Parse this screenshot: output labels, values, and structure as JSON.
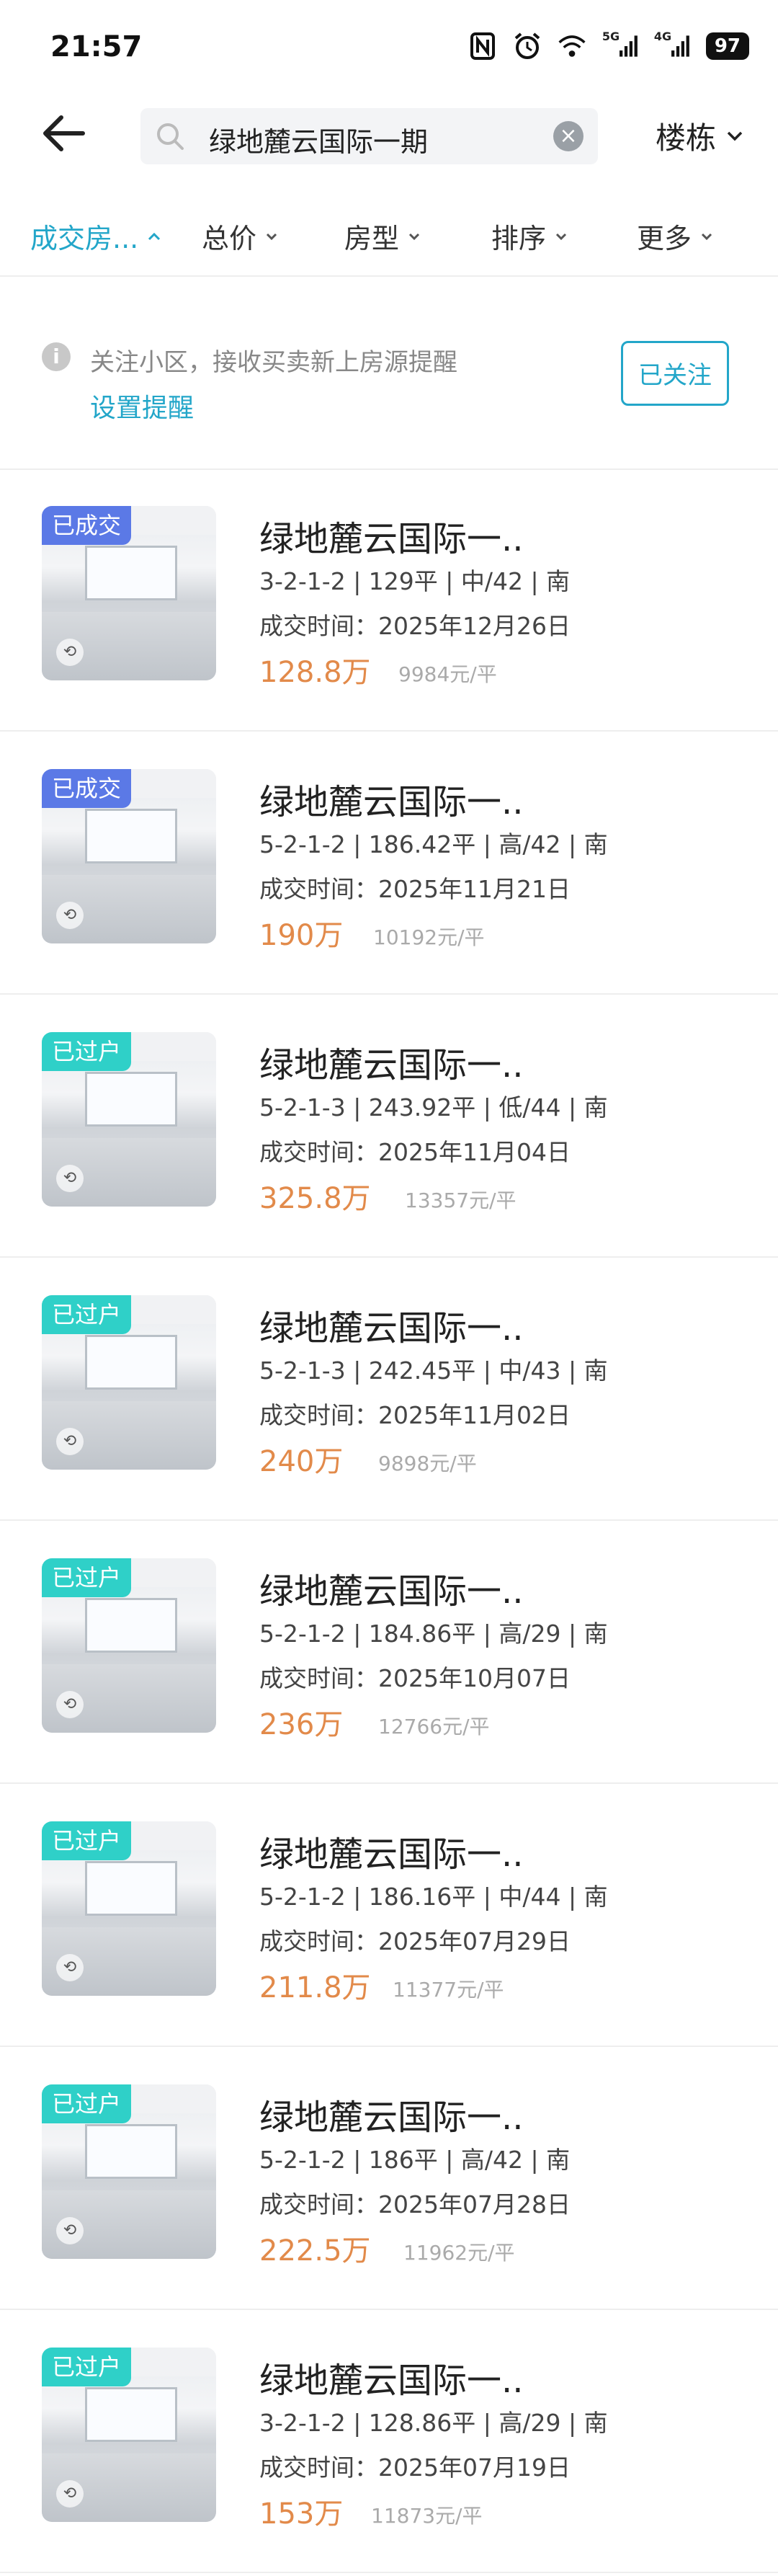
{
  "status_bar": {
    "time": "21:57",
    "battery": "97",
    "network_1": "5G",
    "network_2": "4G"
  },
  "search": {
    "value": "绿地麓云国际一期",
    "clear_icon": "clear-icon"
  },
  "building_filter": {
    "label": "楼栋"
  },
  "filters": [
    {
      "label": "成交房...",
      "active": true
    },
    {
      "label": "总价",
      "active": false
    },
    {
      "label": "房型",
      "active": false
    },
    {
      "label": "排序",
      "active": false
    },
    {
      "label": "更多",
      "active": false
    }
  ],
  "follow": {
    "message": "关注小区，接收买卖新上房源提醒",
    "link": "设置提醒",
    "button": "已关注"
  },
  "colors": {
    "accent": "#23a6c9",
    "price": "#e28a4a",
    "badge_sold": "#5b79e6",
    "badge_transferred": "#2fd0c8"
  },
  "listings": [
    {
      "badge": "已成交",
      "title": "绿地麓云国际一..",
      "specs": "3-2-1-2 | 129平 | 中/42 | 南",
      "date": "成交时间：2025年12月26日",
      "price": "128.8万",
      "unit_price": "9984元/平"
    },
    {
      "badge": "已成交",
      "title": "绿地麓云国际一..",
      "specs": "5-2-1-2 | 186.42平 | 高/42 | 南",
      "date": "成交时间：2025年11月21日",
      "price": "190万",
      "unit_price": "10192元/平"
    },
    {
      "badge": "已过户",
      "title": "绿地麓云国际一..",
      "specs": "5-2-1-3 | 243.92平 | 低/44 | 南",
      "date": "成交时间：2025年11月04日",
      "price": "325.8万",
      "unit_price": "13357元/平"
    },
    {
      "badge": "已过户",
      "title": "绿地麓云国际一..",
      "specs": "5-2-1-3 | 242.45平 | 中/43 | 南",
      "date": "成交时间：2025年11月02日",
      "price": "240万",
      "unit_price": "9898元/平"
    },
    {
      "badge": "已过户",
      "title": "绿地麓云国际一..",
      "specs": "5-2-1-2 | 184.86平 | 高/29 | 南",
      "date": "成交时间：2025年10月07日",
      "price": "236万",
      "unit_price": "12766元/平"
    },
    {
      "badge": "已过户",
      "title": "绿地麓云国际一..",
      "specs": "5-2-1-2 | 186.16平 | 中/44 | 南",
      "date": "成交时间：2025年07月29日",
      "price": "211.8万",
      "unit_price": "11377元/平"
    },
    {
      "badge": "已过户",
      "title": "绿地麓云国际一..",
      "specs": "5-2-1-2 | 186平 | 高/42 | 南",
      "date": "成交时间：2025年07月28日",
      "price": "222.5万",
      "unit_price": "11962元/平"
    },
    {
      "badge": "已过户",
      "title": "绿地麓云国际一..",
      "specs": "3-2-1-2 | 128.86平 | 高/29 | 南",
      "date": "成交时间：2025年07月19日",
      "price": "153万",
      "unit_price": "11873元/平"
    }
  ]
}
